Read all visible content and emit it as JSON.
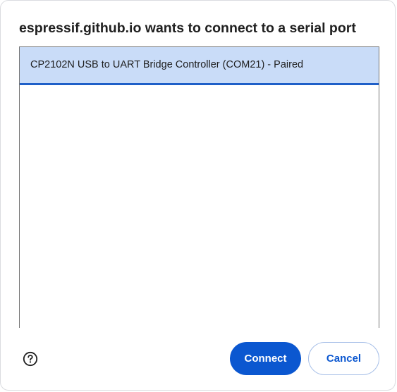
{
  "dialog": {
    "title": "espressif.github.io wants to connect to a serial port"
  },
  "ports": [
    {
      "label": "CP2102N USB to UART Bridge Controller (COM21) - Paired",
      "selected": true
    }
  ],
  "footer": {
    "help_icon": "help-circle-icon",
    "connect_label": "Connect",
    "cancel_label": "Cancel"
  },
  "colors": {
    "accent": "#0b57d0",
    "selection": "#c9dcf8"
  }
}
